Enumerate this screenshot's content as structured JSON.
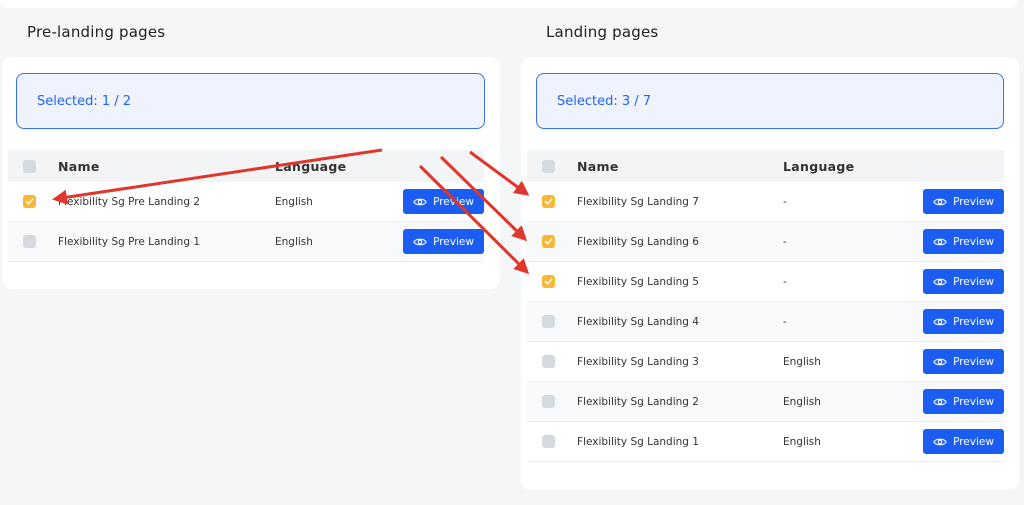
{
  "pre_landing": {
    "title": "Pre-landing pages",
    "selected": "Selected: 1 / 2",
    "headers": {
      "name": "Name",
      "language": "Language"
    },
    "rows": [
      {
        "name": "Flexibility Sg Pre Landing 2",
        "language": "English",
        "checked": true,
        "preview": "Preview"
      },
      {
        "name": "Flexibility Sg Pre Landing 1",
        "language": "English",
        "checked": false,
        "preview": "Preview"
      }
    ]
  },
  "landing": {
    "title": "Landing pages",
    "selected": "Selected: 3 / 7",
    "headers": {
      "name": "Name",
      "language": "Language"
    },
    "rows": [
      {
        "name": "Flexibility Sg Landing 7",
        "language": "-",
        "checked": true,
        "preview": "Preview"
      },
      {
        "name": "Flexibility Sg Landing 6",
        "language": "-",
        "checked": true,
        "preview": "Preview"
      },
      {
        "name": "Flexibility Sg Landing 5",
        "language": "-",
        "checked": true,
        "preview": "Preview"
      },
      {
        "name": "Flexibility Sg Landing 4",
        "language": "-",
        "checked": false,
        "preview": "Preview"
      },
      {
        "name": "Flexibility Sg Landing 3",
        "language": "English",
        "checked": false,
        "preview": "Preview"
      },
      {
        "name": "Flexibility Sg Landing 2",
        "language": "English",
        "checked": false,
        "preview": "Preview"
      },
      {
        "name": "Flexibility Sg Landing 1",
        "language": "English",
        "checked": false,
        "preview": "Preview"
      }
    ]
  },
  "colors": {
    "accent": "#1b5cf2",
    "checked": "#f7b637",
    "annotation_arrow": "#e0362c"
  }
}
